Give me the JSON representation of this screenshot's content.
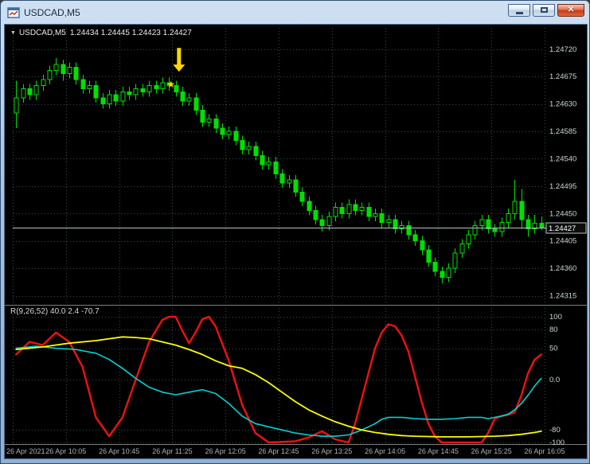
{
  "window": {
    "title": "USDCAD,M5",
    "controls": [
      "minimize",
      "maximize",
      "close"
    ]
  },
  "colors": {
    "background": "#000000",
    "candle": "#00e000",
    "grid": "#335043",
    "separator": "#7f7f7f",
    "axis_text": "#ccd6d6",
    "time_text": "#a9b2b2",
    "price_line": "#b9c4c4",
    "red_line": "#f01010",
    "cyan_line": "#00d2d2",
    "yellow_line": "#fbfb00",
    "annotation_yellow": "#ffd800"
  },
  "chart": {
    "header": {
      "symbol": "USDCAD,M5",
      "values": "1.24434 1.24445 1.24423 1.24427"
    }
  },
  "indicator": {
    "label": "R(9,26,52) 40.0 2.4 -70.7",
    "axis_labels": [
      {
        "text": "100",
        "value": 100
      },
      {
        "text": "80",
        "value": 80
      },
      {
        "text": "50",
        "value": 50
      },
      {
        "text": "0.0",
        "value": 0
      },
      {
        "text": "-80",
        "value": -80
      },
      {
        "text": "-100",
        "value": -100
      }
    ]
  },
  "price_axis": {
    "current": "1.24427",
    "labels": [
      {
        "text": "1.24720",
        "value": 1.2472
      },
      {
        "text": "1.24675",
        "value": 1.24675
      },
      {
        "text": "1.24630",
        "value": 1.2463
      },
      {
        "text": "1.24585",
        "value": 1.24585
      },
      {
        "text": "1.24540",
        "value": 1.2454
      },
      {
        "text": "1.24495",
        "value": 1.24495
      },
      {
        "text": "1.24450",
        "value": 1.2445
      },
      {
        "text": "1.24405",
        "value": 1.24405
      },
      {
        "text": "1.24360",
        "value": 1.2436
      },
      {
        "text": "1.24315",
        "value": 1.24315
      }
    ]
  },
  "time_axis": {
    "labels": [
      "26 Apr 2021",
      "26 Apr 10:05",
      "26 Apr 10:45",
      "26 Apr 11:25",
      "26 Apr 12:05",
      "26 Apr 12:45",
      "26 Apr 13:25",
      "26 Apr 14:05",
      "26 Apr 14:45",
      "26 Apr 15:25",
      "26 Apr 16:05"
    ]
  },
  "chart_data": {
    "type": "candlestick",
    "symbol": "USDCAD",
    "timeframe": "M5",
    "price_range": {
      "min": 1.243,
      "max": 1.24755
    },
    "current_price": 1.24427,
    "candles": [
      [
        1.24615,
        1.24668,
        1.2459,
        1.2464
      ],
      [
        1.2464,
        1.24663,
        1.24632,
        1.24655
      ],
      [
        1.24655,
        1.24663,
        1.24637,
        1.24645
      ],
      [
        1.24645,
        1.24668,
        1.24637,
        1.2466
      ],
      [
        1.2466,
        1.24678,
        1.24652,
        1.2467
      ],
      [
        1.2467,
        1.24693,
        1.24662,
        1.24685
      ],
      [
        1.24685,
        1.24705,
        1.24677,
        1.24695
      ],
      [
        1.24695,
        1.24703,
        1.24668,
        1.2468
      ],
      [
        1.2468,
        1.24698,
        1.24672,
        1.2469
      ],
      [
        1.2469,
        1.24698,
        1.24662,
        1.2467
      ],
      [
        1.2467,
        1.24678,
        1.24647,
        1.24655
      ],
      [
        1.24655,
        1.24668,
        1.24647,
        1.2466
      ],
      [
        1.2466,
        1.24668,
        1.24632,
        1.2464
      ],
      [
        1.2464,
        1.24648,
        1.24622,
        1.2463
      ],
      [
        1.2463,
        1.24653,
        1.24622,
        1.24645
      ],
      [
        1.24645,
        1.24653,
        1.24627,
        1.24635
      ],
      [
        1.24635,
        1.24658,
        1.24627,
        1.2465
      ],
      [
        1.2465,
        1.24658,
        1.24637,
        1.24645
      ],
      [
        1.24645,
        1.24663,
        1.24637,
        1.24655
      ],
      [
        1.24655,
        1.24663,
        1.24642,
        1.2465
      ],
      [
        1.2465,
        1.24668,
        1.24642,
        1.2466
      ],
      [
        1.2466,
        1.24668,
        1.24647,
        1.24655
      ],
      [
        1.24655,
        1.24673,
        1.24647,
        1.24665
      ],
      [
        1.24665,
        1.24673,
        1.24652,
        1.2466
      ],
      [
        1.2466,
        1.24668,
        1.24642,
        1.2465
      ],
      [
        1.2465,
        1.24658,
        1.24627,
        1.24635
      ],
      [
        1.24635,
        1.24648,
        1.24627,
        1.2464
      ],
      [
        1.2464,
        1.24648,
        1.24612,
        1.2462
      ],
      [
        1.2462,
        1.24628,
        1.24592,
        1.246
      ],
      [
        1.246,
        1.24613,
        1.24592,
        1.24605
      ],
      [
        1.24605,
        1.24613,
        1.24582,
        1.2459
      ],
      [
        1.2459,
        1.24598,
        1.24572,
        1.2458
      ],
      [
        1.2458,
        1.24593,
        1.24572,
        1.24585
      ],
      [
        1.24585,
        1.24593,
        1.24562,
        1.2457
      ],
      [
        1.2457,
        1.24578,
        1.24547,
        1.24555
      ],
      [
        1.24555,
        1.24568,
        1.24547,
        1.2456
      ],
      [
        1.2456,
        1.24568,
        1.24537,
        1.24545
      ],
      [
        1.24545,
        1.24553,
        1.24522,
        1.2453
      ],
      [
        1.2453,
        1.24543,
        1.24522,
        1.24535
      ],
      [
        1.24535,
        1.24543,
        1.24507,
        1.24515
      ],
      [
        1.24515,
        1.24523,
        1.24492,
        1.245
      ],
      [
        1.245,
        1.24513,
        1.24492,
        1.24505
      ],
      [
        1.24505,
        1.24513,
        1.24477,
        1.24485
      ],
      [
        1.24485,
        1.24493,
        1.24462,
        1.2447
      ],
      [
        1.2447,
        1.24478,
        1.24447,
        1.24455
      ],
      [
        1.24455,
        1.24463,
        1.24432,
        1.2444
      ],
      [
        1.2444,
        1.24448,
        1.2442,
        1.2443
      ],
      [
        1.2443,
        1.24453,
        1.24422,
        1.24445
      ],
      [
        1.24445,
        1.24468,
        1.24437,
        1.2446
      ],
      [
        1.2446,
        1.24468,
        1.24442,
        1.2445
      ],
      [
        1.2445,
        1.24473,
        1.24442,
        1.24465
      ],
      [
        1.24465,
        1.24473,
        1.24447,
        1.24455
      ],
      [
        1.24455,
        1.24468,
        1.24447,
        1.2446
      ],
      [
        1.2446,
        1.24468,
        1.24437,
        1.24445
      ],
      [
        1.24445,
        1.24458,
        1.24437,
        1.2445
      ],
      [
        1.2445,
        1.24458,
        1.24427,
        1.24435
      ],
      [
        1.24435,
        1.24448,
        1.24427,
        1.2444
      ],
      [
        1.2444,
        1.24448,
        1.24417,
        1.24425
      ],
      [
        1.24425,
        1.24438,
        1.24417,
        1.2443
      ],
      [
        1.2443,
        1.24438,
        1.24407,
        1.24415
      ],
      [
        1.24415,
        1.24423,
        1.24397,
        1.24405
      ],
      [
        1.24405,
        1.24413,
        1.24382,
        1.2439
      ],
      [
        1.2439,
        1.24398,
        1.24362,
        1.2437
      ],
      [
        1.2437,
        1.24378,
        1.24347,
        1.24355
      ],
      [
        1.24355,
        1.24363,
        1.24335,
        1.24345
      ],
      [
        1.24345,
        1.24368,
        1.24337,
        1.2436
      ],
      [
        1.2436,
        1.24393,
        1.24352,
        1.24385
      ],
      [
        1.24385,
        1.24408,
        1.24377,
        1.244
      ],
      [
        1.244,
        1.24423,
        1.24392,
        1.24415
      ],
      [
        1.24415,
        1.24438,
        1.24407,
        1.2443
      ],
      [
        1.2443,
        1.24448,
        1.24422,
        1.2444
      ],
      [
        1.2444,
        1.24448,
        1.24417,
        1.24425
      ],
      [
        1.24425,
        1.24433,
        1.24412,
        1.2442
      ],
      [
        1.2442,
        1.24443,
        1.24412,
        1.24435
      ],
      [
        1.24435,
        1.24458,
        1.24427,
        1.2445
      ],
      [
        1.2445,
        1.24505,
        1.2444,
        1.2447
      ],
      [
        1.2447,
        1.2449,
        1.24425,
        1.2444
      ],
      [
        1.2444,
        1.24448,
        1.24412,
        1.24425
      ],
      [
        1.24425,
        1.24448,
        1.24417,
        1.24434
      ],
      [
        1.24434,
        1.24445,
        1.24423,
        1.24427
      ]
    ],
    "indicator": {
      "name": "R(9,26,52)",
      "values_label": "40.0 2.4 -70.7",
      "range": [
        -100,
        100
      ],
      "series": [
        {
          "name": "red",
          "color": "#f01010",
          "points": [
            [
              0,
              40
            ],
            [
              2,
              60
            ],
            [
              4,
              55
            ],
            [
              6,
              75
            ],
            [
              8,
              60
            ],
            [
              10,
              20
            ],
            [
              12,
              -60
            ],
            [
              14,
              -90
            ],
            [
              16,
              -60
            ],
            [
              18,
              0
            ],
            [
              20,
              60
            ],
            [
              22,
              95
            ],
            [
              23,
              100
            ],
            [
              24,
              100
            ],
            [
              25,
              78
            ],
            [
              26,
              58
            ],
            [
              27,
              75
            ],
            [
              28,
              96
            ],
            [
              29,
              100
            ],
            [
              30,
              85
            ],
            [
              32,
              30
            ],
            [
              34,
              -40
            ],
            [
              36,
              -85
            ],
            [
              38,
              -100
            ],
            [
              42,
              -98
            ],
            [
              44,
              -92
            ],
            [
              46,
              -82
            ],
            [
              48,
              -95
            ],
            [
              50,
              -100
            ],
            [
              51,
              -70
            ],
            [
              52,
              -30
            ],
            [
              53,
              10
            ],
            [
              54,
              50
            ],
            [
              55,
              75
            ],
            [
              56,
              88
            ],
            [
              57,
              85
            ],
            [
              58,
              70
            ],
            [
              59,
              45
            ],
            [
              60,
              5
            ],
            [
              61,
              -35
            ],
            [
              62,
              -70
            ],
            [
              63,
              -90
            ],
            [
              64,
              -100
            ],
            [
              68,
              -100
            ],
            [
              70,
              -100
            ],
            [
              71,
              -85
            ],
            [
              72,
              -62
            ],
            [
              73,
              -58
            ],
            [
              74,
              -56
            ],
            [
              75,
              -52
            ],
            [
              76,
              -25
            ],
            [
              77,
              10
            ],
            [
              78,
              32
            ],
            [
              79,
              40
            ]
          ]
        },
        {
          "name": "cyan",
          "color": "#00d2d2",
          "points": [
            [
              0,
              50
            ],
            [
              3,
              53
            ],
            [
              6,
              50
            ],
            [
              9,
              48
            ],
            [
              12,
              42
            ],
            [
              14,
              32
            ],
            [
              16,
              18
            ],
            [
              18,
              2
            ],
            [
              20,
              -12
            ],
            [
              22,
              -20
            ],
            [
              24,
              -24
            ],
            [
              26,
              -20
            ],
            [
              28,
              -16
            ],
            [
              30,
              -22
            ],
            [
              32,
              -38
            ],
            [
              34,
              -58
            ],
            [
              36,
              -70
            ],
            [
              38,
              -75
            ],
            [
              40,
              -80
            ],
            [
              42,
              -85
            ],
            [
              44,
              -88
            ],
            [
              46,
              -90
            ],
            [
              48,
              -90
            ],
            [
              50,
              -88
            ],
            [
              52,
              -80
            ],
            [
              54,
              -70
            ],
            [
              55,
              -63
            ],
            [
              56,
              -60
            ],
            [
              58,
              -60
            ],
            [
              60,
              -62
            ],
            [
              62,
              -63
            ],
            [
              64,
              -63
            ],
            [
              66,
              -62
            ],
            [
              68,
              -60
            ],
            [
              70,
              -60
            ],
            [
              71,
              -62
            ],
            [
              72,
              -60
            ],
            [
              73,
              -58
            ],
            [
              74,
              -55
            ],
            [
              75,
              -48
            ],
            [
              76,
              -38
            ],
            [
              77,
              -25
            ],
            [
              78,
              -10
            ],
            [
              79,
              2
            ]
          ]
        },
        {
          "name": "yellow",
          "color": "#fbfb00",
          "points": [
            [
              0,
              48
            ],
            [
              4,
              52
            ],
            [
              8,
              58
            ],
            [
              12,
              62
            ],
            [
              14,
              65
            ],
            [
              16,
              68
            ],
            [
              18,
              67
            ],
            [
              20,
              65
            ],
            [
              22,
              60
            ],
            [
              24,
              55
            ],
            [
              26,
              48
            ],
            [
              28,
              40
            ],
            [
              30,
              30
            ],
            [
              32,
              22
            ],
            [
              34,
              18
            ],
            [
              36,
              8
            ],
            [
              38,
              -5
            ],
            [
              40,
              -20
            ],
            [
              42,
              -35
            ],
            [
              44,
              -48
            ],
            [
              46,
              -58
            ],
            [
              48,
              -67
            ],
            [
              50,
              -74
            ],
            [
              52,
              -80
            ],
            [
              54,
              -84
            ],
            [
              56,
              -87
            ],
            [
              58,
              -89
            ],
            [
              60,
              -90
            ],
            [
              64,
              -91
            ],
            [
              68,
              -91
            ],
            [
              72,
              -90
            ],
            [
              74,
              -89
            ],
            [
              76,
              -87
            ],
            [
              78,
              -84
            ],
            [
              79,
              -82
            ]
          ]
        }
      ]
    },
    "annotations": [
      {
        "type": "arrow-down",
        "color": "#ffd800",
        "index": 24.5,
        "price": 1.24722,
        "tip_price": 1.24683
      },
      {
        "type": "star",
        "color": "#ffd800",
        "index": 23.3,
        "price": 1.24662
      }
    ]
  }
}
